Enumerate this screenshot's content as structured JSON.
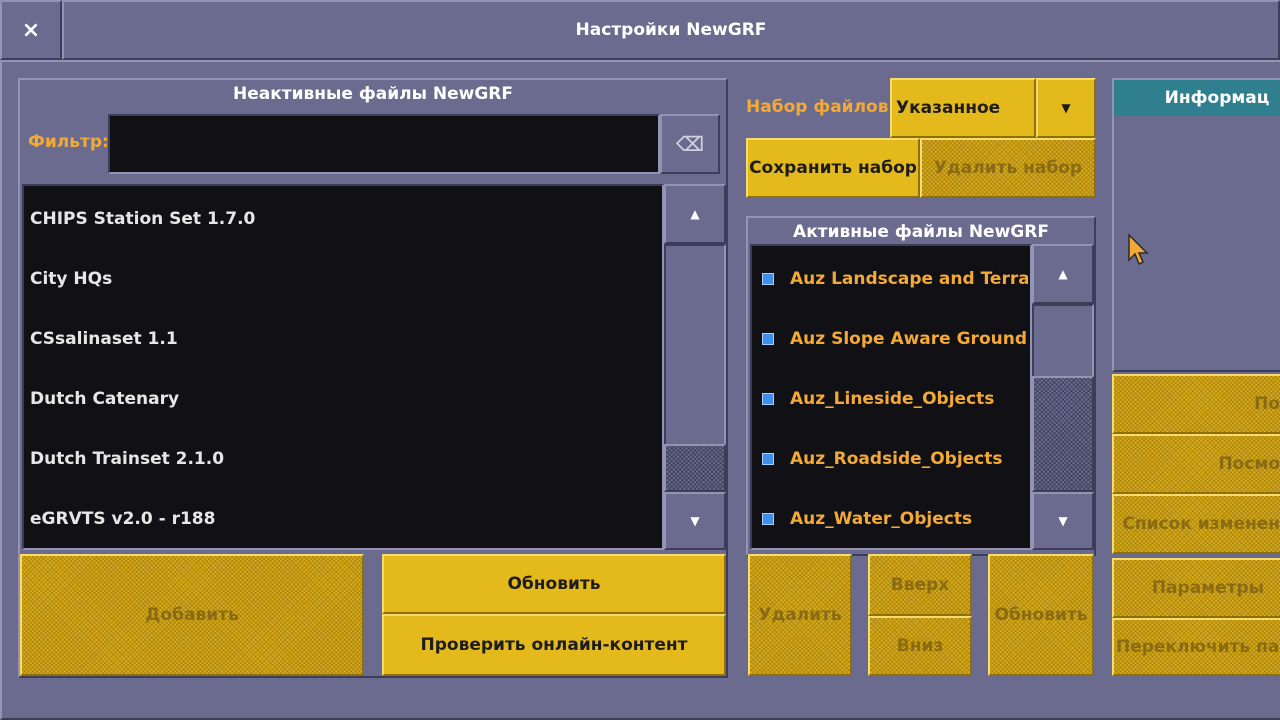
{
  "window": {
    "close_glyph": "×",
    "title": "Настройки NewGRF"
  },
  "inactive": {
    "title": "Неактивные файлы NewGRF",
    "filter_label": "Фильтр:",
    "filter_value": "",
    "clear_glyph": "⌫",
    "items": [
      "CHIPS Station Set 1.7.0",
      "City HQs",
      "CSsalinaset 1.1",
      "Dutch Catenary",
      "Dutch Trainset 2.1.0",
      "eGRVTS v2.0 - r188"
    ],
    "add_button": "Добавить",
    "refresh_button": "Обновить",
    "check_online_button": "Проверить онлайн-контент"
  },
  "preset": {
    "label": "Набор файлов:",
    "selected": "Указанное",
    "save_button": "Сохранить набор",
    "delete_button": "Удалить набор"
  },
  "active": {
    "title": "Активные файлы NewGRF",
    "items": [
      "Auz Landscape and Terrai...",
      "Auz Slope Aware Ground ...",
      "Auz_Lineside_Objects",
      "Auz_Roadside_Objects",
      "Auz_Water_Objects"
    ],
    "remove_button": "Удалить",
    "up_button": "Вверх",
    "down_button": "Вниз",
    "apply_button": "Обновить"
  },
  "info": {
    "title": "Информац",
    "buttons": [
      "По",
      "Посмо",
      "Список изменен",
      "Параметры",
      "Переключить пал"
    ]
  },
  "colors": {
    "background": "#6a6b8f",
    "button_yellow": "#e4b91c",
    "active_text": "#f2a935",
    "list_bg": "#111015",
    "info_header": "#2f7f8f"
  }
}
